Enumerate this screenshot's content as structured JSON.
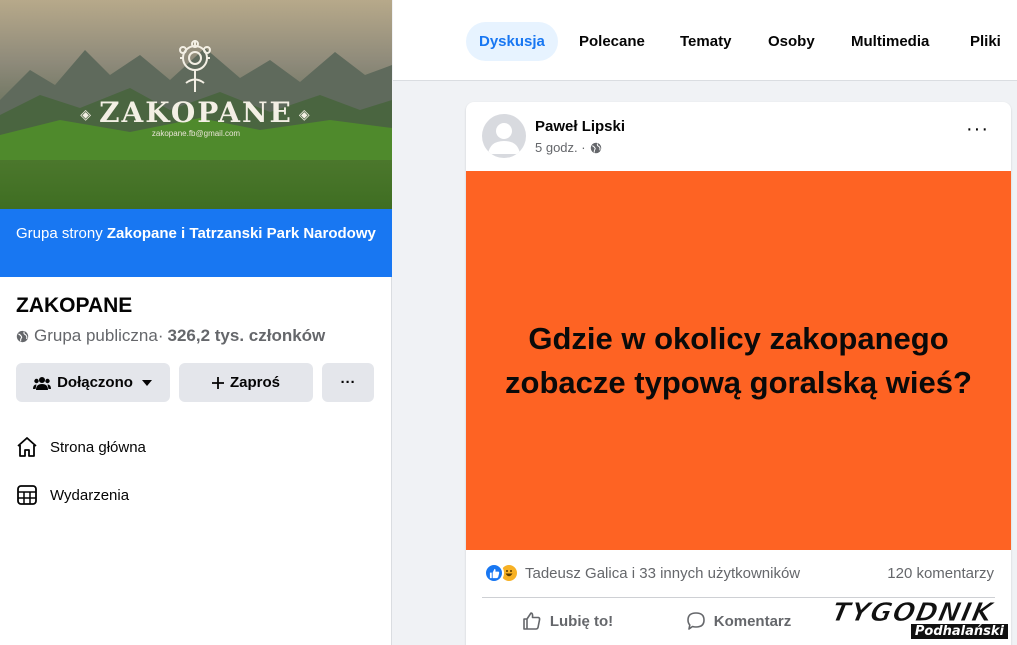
{
  "cover": {
    "title": "ZAKOPANE",
    "email": "zakopane.fb@gmail.com"
  },
  "group": {
    "banner_prefix": "Grupa strony ",
    "banner_page": "Zakopane i Tatrzanski Park Narodowy",
    "name": "ZAKOPANE",
    "type": "Grupa publiczna",
    "separator": " · ",
    "members": "326,2 tys. członków"
  },
  "buttons": {
    "joined": "Dołączono",
    "invite": "Zaproś",
    "more": "···"
  },
  "nav": {
    "home": "Strona główna",
    "events": "Wydarzenia"
  },
  "tabs": [
    "Dyskusja",
    "Polecane",
    "Tematy",
    "Osoby",
    "Multimedia",
    "Pliki"
  ],
  "post": {
    "author": "Paweł Lipski",
    "time": "5 godz. ·",
    "menu": "···",
    "image_text": "Gdzie w okolicy zakopanego zobacze typową goralską wieś?",
    "reactions_text": "Tadeusz Galica i 33 innych użytkowników",
    "comments": "120 komentarzy",
    "like": "Lubię to!",
    "comment": "Komentarz"
  },
  "watermark": {
    "top": "TYGODNIK",
    "bottom": "Podhalański"
  },
  "colors": {
    "accent": "#1877f2",
    "post_background": "#fe6323",
    "page_bg": "#f0f2f5"
  }
}
